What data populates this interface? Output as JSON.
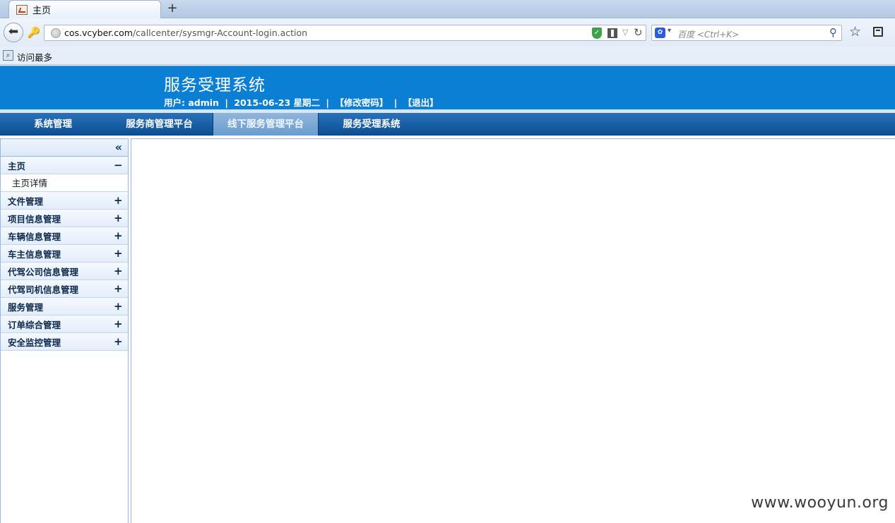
{
  "browser": {
    "tab_title": "主页",
    "new_tab_label": "+",
    "url_host": "cos.vcyber.com",
    "url_path": "/callcenter/sysmgr-Account-login.action",
    "search_placeholder": "百度 <Ctrl+K>",
    "bookmark_label": "访问最多"
  },
  "header": {
    "title": "服务受理系统",
    "user_prefix": "用户: admin",
    "sep1": "|",
    "date": "2015-06-23 星期二",
    "sep2": "|",
    "change_password": "【修改密码】",
    "sep3": "|",
    "logout": "【退出】"
  },
  "topmenu": {
    "items": [
      {
        "label": "系统管理"
      },
      {
        "label": "服务商管理平台"
      },
      {
        "label": "线下服务管理平台"
      },
      {
        "label": "服务受理系统"
      }
    ],
    "active_index": 2
  },
  "sidebar": {
    "collapse_label": "«",
    "groups": [
      {
        "label": "主页",
        "toggle": "−",
        "children": [
          "主页详情"
        ]
      },
      {
        "label": "文件管理",
        "toggle": "+"
      },
      {
        "label": "项目信息管理",
        "toggle": "+"
      },
      {
        "label": "车辆信息管理",
        "toggle": "+"
      },
      {
        "label": "车主信息管理",
        "toggle": "+"
      },
      {
        "label": "代驾公司信息管理",
        "toggle": "+"
      },
      {
        "label": "代驾司机信息管理",
        "toggle": "+"
      },
      {
        "label": "服务管理",
        "toggle": "+"
      },
      {
        "label": "订单综合管理",
        "toggle": "+"
      },
      {
        "label": "安全监控管理",
        "toggle": "+"
      }
    ]
  },
  "watermark": "www.wooyun.org",
  "colors": {
    "header_blue": "#0a7fd4",
    "menu_blue": "#0c4f95",
    "menu_active": "#6a9cce"
  }
}
